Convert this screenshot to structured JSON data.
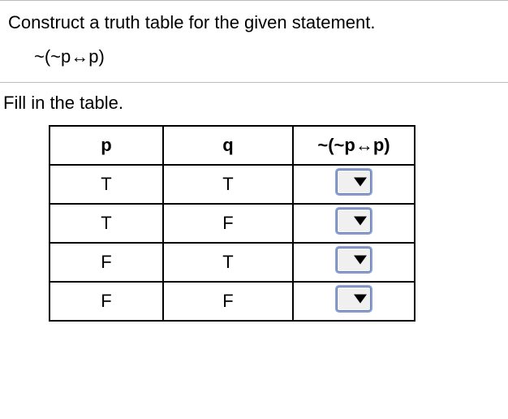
{
  "instruction": "Construct a truth table for the given statement.",
  "expression": "~(~p↔p)",
  "fillin_text": "Fill in the table.",
  "table": {
    "headers": {
      "col1": "p",
      "col2": "q",
      "col3": "~(~p↔p)"
    },
    "rows": [
      {
        "p": "T",
        "q": "T",
        "result": ""
      },
      {
        "p": "T",
        "q": "F",
        "result": ""
      },
      {
        "p": "F",
        "q": "T",
        "result": ""
      },
      {
        "p": "F",
        "q": "F",
        "result": ""
      }
    ]
  }
}
